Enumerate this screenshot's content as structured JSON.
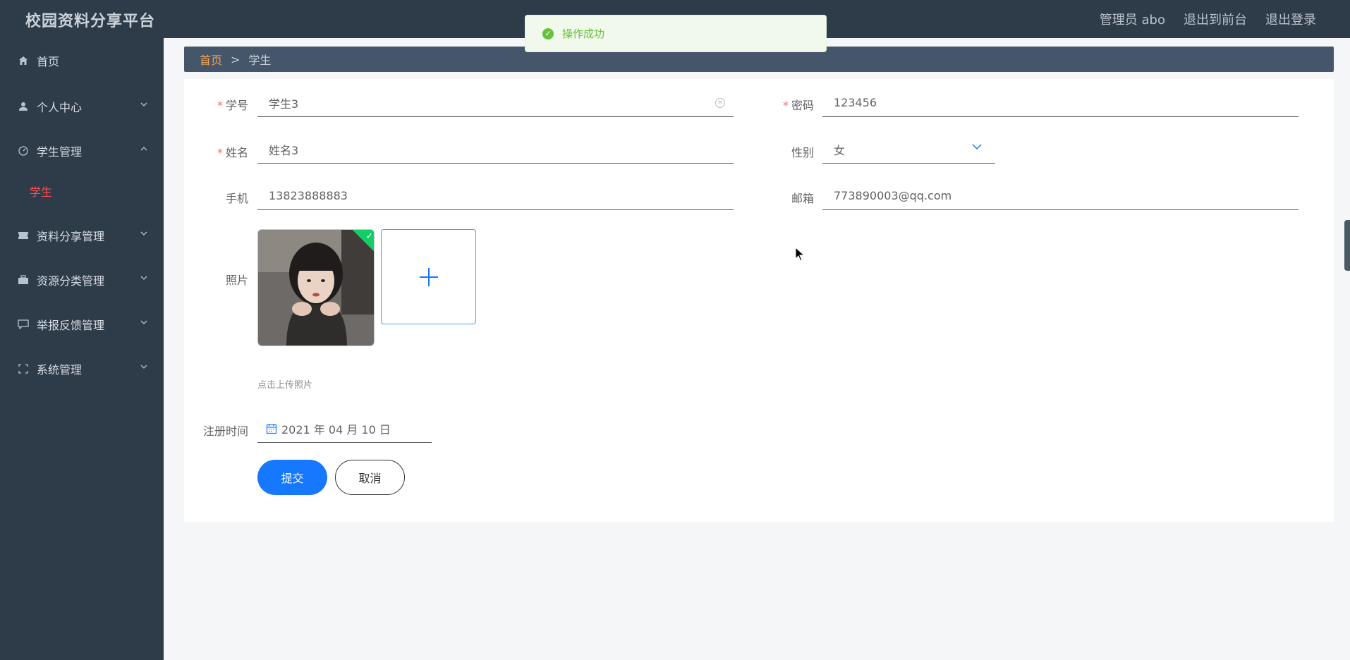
{
  "app": {
    "brand": "校园资料分享平台",
    "admin_label": "管理员 abo",
    "exit_front": "退出到前台",
    "logout": "退出登录"
  },
  "toast": {
    "icon": "check-circle-icon",
    "text": "操作成功",
    "color": "#67c23a"
  },
  "sidebar": {
    "items": [
      {
        "label": "首页",
        "icon": "home-icon"
      },
      {
        "label": "个人中心",
        "icon": "user-icon"
      },
      {
        "label": "学生管理",
        "icon": "dashboard-icon"
      },
      {
        "label": "资料分享管理",
        "icon": "ticket-icon"
      },
      {
        "label": "资源分类管理",
        "icon": "briefcase-icon"
      },
      {
        "label": "举报反馈管理",
        "icon": "message-icon"
      },
      {
        "label": "系统管理",
        "icon": "fullscreen-icon"
      }
    ],
    "sub_active": "学生"
  },
  "breadcrumb": {
    "home": "首页",
    "separator": ">",
    "current": "学生"
  },
  "form": {
    "student_id": {
      "label": "学号",
      "value": "学生3"
    },
    "password": {
      "label": "密码",
      "value": "123456"
    },
    "name": {
      "label": "姓名",
      "value": "姓名3"
    },
    "gender": {
      "label": "性别",
      "value": "女"
    },
    "phone": {
      "label": "手机",
      "value": "13823888883"
    },
    "email": {
      "label": "邮箱",
      "value": "773890003@qq.com"
    },
    "photo": {
      "label": "照片",
      "tip": "点击上传照片"
    },
    "register_time": {
      "label": "注册时间",
      "value": "2021 年 04 月 10 日"
    },
    "submit": "提交",
    "cancel": "取消"
  },
  "colors": {
    "sidebar_bg": "#2e3c4a",
    "accent": "#1677ff",
    "required": "#f56c6c",
    "breadcrumb_home": "#f0a35a"
  }
}
